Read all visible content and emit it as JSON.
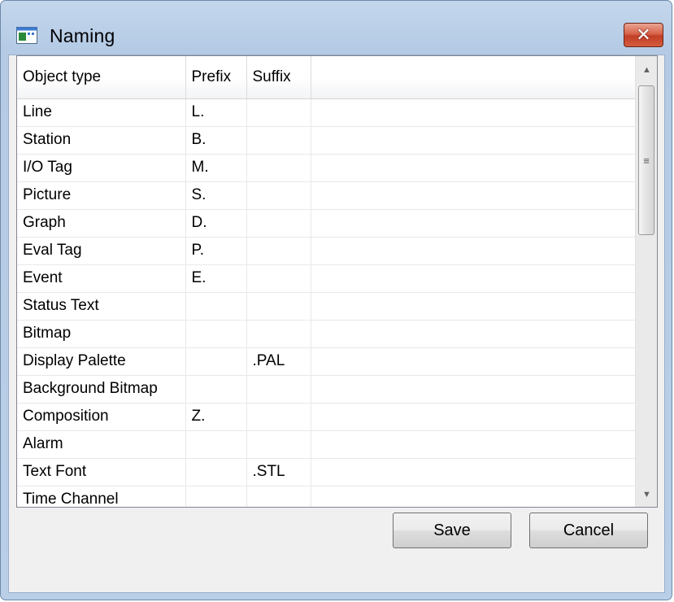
{
  "window": {
    "title": "Naming",
    "close_label": "✕"
  },
  "table": {
    "headers": [
      "Object type",
      "Prefix",
      "Suffix"
    ],
    "rows": [
      [
        "Line",
        "L.",
        ""
      ],
      [
        "Station",
        "B.",
        ""
      ],
      [
        "I/O Tag",
        "M.",
        ""
      ],
      [
        "Picture",
        "S.",
        ""
      ],
      [
        "Graph",
        "D.",
        ""
      ],
      [
        "Eval Tag",
        "P.",
        ""
      ],
      [
        "Event",
        "E.",
        ""
      ],
      [
        "Status Text",
        "",
        ""
      ],
      [
        "Bitmap",
        "",
        ""
      ],
      [
        "Display Palette",
        "",
        ".PAL"
      ],
      [
        "Background Bitmap",
        "",
        ""
      ],
      [
        "Composition",
        "Z.",
        ""
      ],
      [
        "Alarm",
        "",
        ""
      ],
      [
        "Text Font",
        "",
        ".STL"
      ],
      [
        "Time Channel",
        "",
        ""
      ]
    ]
  },
  "scrollbar": {
    "up_arrow": "▲",
    "down_arrow": "▼",
    "grip": "≡"
  },
  "buttons": {
    "save_label": "Save",
    "cancel_label": "Cancel"
  }
}
